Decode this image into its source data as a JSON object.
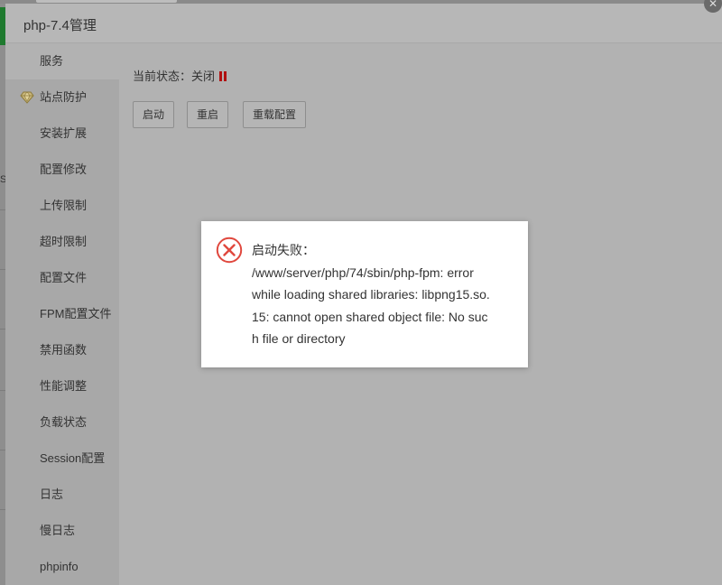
{
  "panel": {
    "title": "php-7.4管理",
    "close_glyph": "✕"
  },
  "sidebar": {
    "items": [
      {
        "label": "服务"
      },
      {
        "label": "站点防护"
      },
      {
        "label": "安装扩展"
      },
      {
        "label": "配置修改"
      },
      {
        "label": "上传限制"
      },
      {
        "label": "超时限制"
      },
      {
        "label": "配置文件"
      },
      {
        "label": "FPM配置文件"
      },
      {
        "label": "禁用函数"
      },
      {
        "label": "性能调整"
      },
      {
        "label": "负载状态"
      },
      {
        "label": "Session配置"
      },
      {
        "label": "日志"
      },
      {
        "label": "慢日志"
      },
      {
        "label": "phpinfo"
      }
    ]
  },
  "service": {
    "status_label": "当前状态：",
    "status_value": "关闭",
    "buttons": {
      "start": "启动",
      "restart": "重启",
      "reload": "重载配置"
    }
  },
  "alert": {
    "lines": [
      "启动失败：",
      "/www/server/php/74/sbin/php-fpm: error",
      "while loading shared libraries: libpng15.so.",
      "15: cannot open shared object file: No suc",
      "h file or directory"
    ]
  },
  "background": {
    "fragment": "S"
  },
  "colors": {
    "error": "#e0483e",
    "status_off": "#b01010",
    "background_green": "#1f7a2f"
  },
  "icons": {
    "alert": "error-circle-x-icon",
    "protect": "diamond-icon",
    "status": "pause-icon"
  }
}
